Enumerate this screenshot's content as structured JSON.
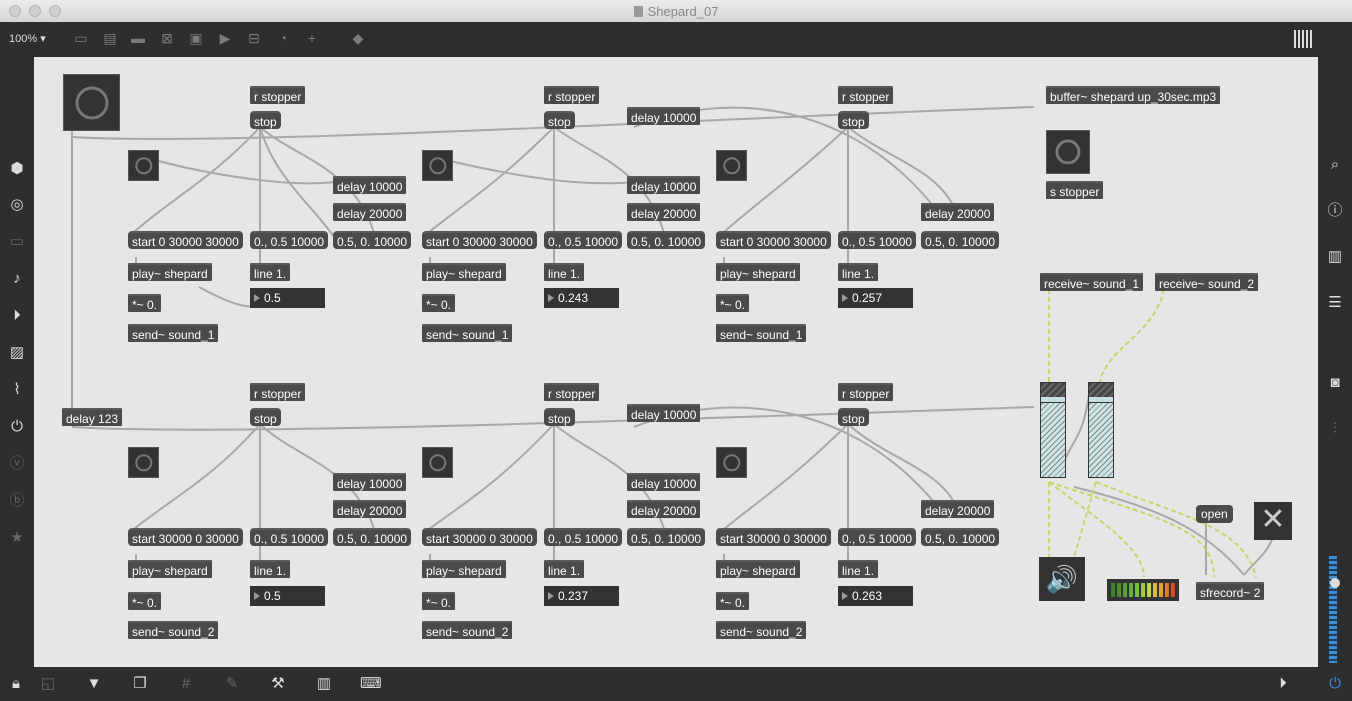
{
  "window": {
    "title": "Shepard_07",
    "zoom": "100%"
  },
  "patch": {
    "row1": {
      "r_stopper_a": "r stopper",
      "stop_a": "stop",
      "r_stopper_b": "r stopper",
      "stop_b": "stop",
      "r_stopper_c": "r stopper",
      "stop_c": "stop",
      "delay_top": "delay 10000",
      "v1_delay10000": "delay 10000",
      "v1_delay20000": "delay 20000",
      "v1_start": "start 0 30000 30000",
      "v1_ramp_up": "0., 0.5 10000",
      "v1_ramp_down": "0.5, 0. 10000",
      "v1_play": "play~ shepard",
      "v1_line": "line 1.",
      "v1_value": "0.5",
      "v1_mul": "*~ 0.",
      "v1_send": "send~ sound_1",
      "v2_delay10000": "delay 10000",
      "v2_delay20000": "delay 20000",
      "v2_start": "start 0 30000 30000",
      "v2_ramp_up": "0., 0.5 10000",
      "v2_ramp_down": "0.5, 0. 10000",
      "v2_play": "play~ shepard",
      "v2_line": "line 1.",
      "v2_value": "0.243",
      "v2_mul": "*~ 0.",
      "v2_send": "send~ sound_1",
      "v3_delay20000": "delay 20000",
      "v3_start": "start 0 30000 30000",
      "v3_ramp_up": "0., 0.5 10000",
      "v3_ramp_down": "0.5, 0. 10000",
      "v3_play": "play~ shepard",
      "v3_line": "line 1.",
      "v3_value": "0.257",
      "v3_mul": "*~ 0.",
      "v3_send": "send~ sound_1"
    },
    "row2": {
      "delay123": "delay 123",
      "r_stopper_a": "r stopper",
      "stop_a": "stop",
      "r_stopper_b": "r stopper",
      "stop_b": "stop",
      "r_stopper_c": "r stopper",
      "stop_c": "stop",
      "delay_top": "delay 10000",
      "v1_delay10000": "delay 10000",
      "v1_delay20000": "delay 20000",
      "v1_start": "start 30000 0 30000",
      "v1_ramp_up": "0., 0.5 10000",
      "v1_ramp_down": "0.5, 0. 10000",
      "v1_play": "play~ shepard",
      "v1_line": "line 1.",
      "v1_value": "0.5",
      "v1_mul": "*~ 0.",
      "v1_send": "send~ sound_2",
      "v2_delay10000": "delay 10000",
      "v2_delay20000": "delay 20000",
      "v2_start": "start 30000 0 30000",
      "v2_ramp_up": "0., 0.5 10000",
      "v2_ramp_down": "0.5, 0. 10000",
      "v2_play": "play~ shepard",
      "v2_line": "line 1.",
      "v2_value": "0.237",
      "v2_mul": "*~ 0.",
      "v2_send": "send~ sound_2",
      "v3_delay20000": "delay 20000",
      "v3_start": "start 30000 0 30000",
      "v3_ramp_up": "0., 0.5 10000",
      "v3_ramp_down": "0.5, 0. 10000",
      "v3_play": "play~ shepard",
      "v3_line": "line 1.",
      "v3_value": "0.263",
      "v3_mul": "*~ 0.",
      "v3_send": "send~ sound_2"
    },
    "right": {
      "buffer": "buffer~ shepard up_30sec.mp3",
      "s_stopper": "s stopper",
      "receive1": "receive~ sound_1",
      "receive2": "receive~ sound_2",
      "open": "open",
      "sfrecord": "sfrecord~ 2",
      "close_glyph": "✕",
      "speaker_glyph": "🔊"
    }
  },
  "colors": {
    "canvas": "#e6e6e6",
    "object": "#4a4a4a",
    "chrome": "#2e2e2e",
    "cord": "#a8a8a8",
    "signal_cord": "#c8d36a"
  },
  "left_sidebar": [
    "cube-icon",
    "target-icon",
    "panel-icon",
    "music-note-icon",
    "play-list-icon",
    "image-icon",
    "paperclip-icon",
    "plug-icon",
    "vimeo-icon",
    "bold-h-icon",
    "star-icon"
  ],
  "right_sidebar": [
    "search-icon",
    "info-icon",
    "book-icon",
    "list-icon",
    "camera-icon",
    "mixer-icon"
  ]
}
